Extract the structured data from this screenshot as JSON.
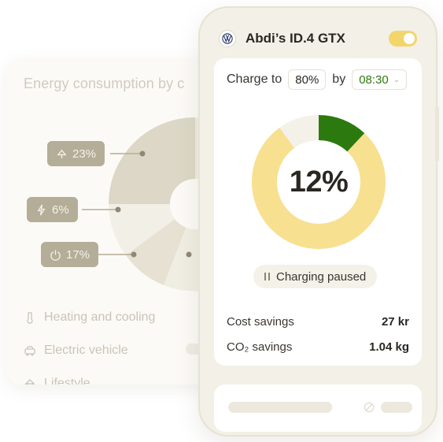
{
  "background_card": {
    "title": "Energy consumption by c",
    "badges": [
      {
        "icon": "lamp-icon",
        "label": "23%"
      },
      {
        "icon": "bolt-icon",
        "label": "6%"
      },
      {
        "icon": "power-icon",
        "label": "17%"
      }
    ],
    "legend": [
      {
        "icon": "thermometer-icon",
        "label": "Heating and cooling"
      },
      {
        "icon": "car-icon",
        "label": "Electric vehicle"
      },
      {
        "icon": "lifestyle-icon",
        "label": "Lifestyle"
      }
    ]
  },
  "phone": {
    "car_name": "Abdi’s ID.4 GTX",
    "brand_icon": "vw-logo-icon",
    "toggle_on": true,
    "charge": {
      "prefix": "Charge to",
      "target": "80%",
      "by": "by",
      "time": "08:30"
    },
    "progress": {
      "label": "12%",
      "value": 0.12,
      "colors": {
        "fill": "#2c7a0f",
        "track": "#f7e08f",
        "rest": "#f4f1e8"
      }
    },
    "status": "Charging paused",
    "stats": [
      {
        "label": "Cost savings",
        "value": "27 kr"
      },
      {
        "label": "CO₂ savings",
        "value": "1.04 kg"
      }
    ]
  },
  "colors": {
    "accent_yellow": "#f2d66b",
    "accent_green": "#2c7a0f",
    "badge_bg": "#b4ad98"
  }
}
